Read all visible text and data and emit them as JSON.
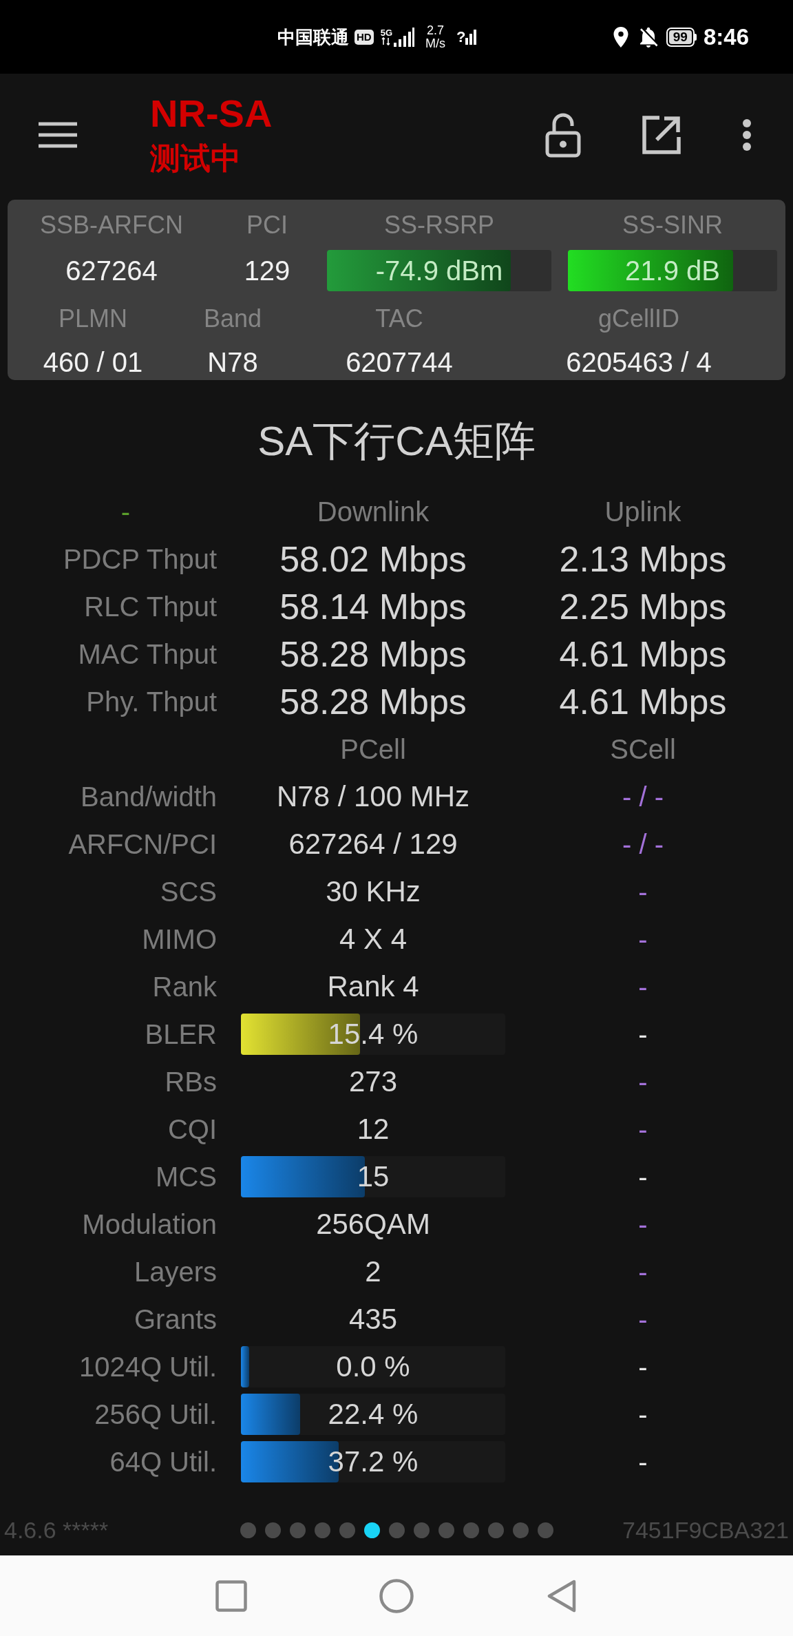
{
  "status_bar": {
    "carrier": "中国联通",
    "hd_badge": "HD",
    "network": "5G",
    "speed_value": "2.7",
    "speed_unit": "M/s",
    "sim2_mark": "?",
    "battery": "99",
    "time": "8:46"
  },
  "toolbar": {
    "title": "NR-SA",
    "subtitle": "测试中"
  },
  "cell_info": {
    "row_1": [
      {
        "kind": "text",
        "label": "SSB-ARFCN",
        "value": "627264"
      },
      {
        "kind": "text",
        "label": "PCI",
        "value": "129"
      },
      {
        "kind": "meter",
        "label": "SS-RSRP",
        "value": "-74.9 dBm",
        "level": 0.82,
        "color": "#239b3b"
      },
      {
        "kind": "meter",
        "label": "SS-SINR",
        "value": "21.9 dB",
        "level": 0.79,
        "color": "#22dd22"
      }
    ],
    "row_2": [
      {
        "label": "PLMN",
        "value": "460 / 01"
      },
      {
        "label": "Band",
        "value": "N78"
      },
      {
        "label": "TAC",
        "value": "6207744"
      },
      {
        "label": "gCellID",
        "value": "6205463 / 4"
      }
    ]
  },
  "matrix": {
    "title": "SA下行CA矩阵",
    "throughput": {
      "header": {
        "label": "-",
        "downlink": "Downlink",
        "uplink": "Uplink"
      },
      "rows": [
        {
          "label": "PDCP Thput",
          "downlink": "58.02 Mbps",
          "uplink": "2.13 Mbps"
        },
        {
          "label": "RLC Thput",
          "downlink": "58.14 Mbps",
          "uplink": "2.25 Mbps"
        },
        {
          "label": "MAC Thput",
          "downlink": "58.28 Mbps",
          "uplink": "4.61 Mbps"
        },
        {
          "label": "Phy. Thput",
          "downlink": "58.28 Mbps",
          "uplink": "4.61 Mbps"
        }
      ]
    },
    "cells": {
      "header": {
        "pcell": "PCell",
        "scell": "SCell"
      },
      "rows": [
        {
          "kind": "text",
          "label": "Band/width",
          "pcell": "N78 / 100 MHz",
          "scell": "- / -"
        },
        {
          "kind": "text",
          "label": "ARFCN/PCI",
          "pcell": "627264 / 129",
          "scell": "- / -"
        },
        {
          "kind": "text",
          "label": "SCS",
          "pcell": "30 KHz",
          "scell": "-"
        },
        {
          "kind": "text",
          "label": "MIMO",
          "pcell": "4 X 4",
          "scell": "-"
        },
        {
          "kind": "text",
          "label": "Rank",
          "pcell": "Rank 4",
          "scell": "-"
        },
        {
          "kind": "bar",
          "label": "BLER",
          "pcell": "15.4 %",
          "scell": "-",
          "level": 0.45,
          "color": "#e2e232"
        },
        {
          "kind": "text",
          "label": "RBs",
          "pcell": "273",
          "scell": "-"
        },
        {
          "kind": "text",
          "label": "CQI",
          "pcell": "12",
          "scell": "-"
        },
        {
          "kind": "bar",
          "label": "MCS",
          "pcell": "15",
          "scell": "-",
          "level": 0.47,
          "color": "#1a86e8"
        },
        {
          "kind": "text",
          "label": "Modulation",
          "pcell": "256QAM",
          "scell": "-"
        },
        {
          "kind": "text",
          "label": "Layers",
          "pcell": "2",
          "scell": "-"
        },
        {
          "kind": "text",
          "label": "Grants",
          "pcell": "435",
          "scell": "-"
        },
        {
          "kind": "bar",
          "label": "1024Q Util.",
          "pcell": "0.0 %",
          "scell": "-",
          "level": 0.03,
          "color": "#1a86e8"
        },
        {
          "kind": "bar",
          "label": "256Q Util.",
          "pcell": "22.4 %",
          "scell": "-",
          "level": 0.225,
          "color": "#1a86e8"
        },
        {
          "kind": "bar",
          "label": "64Q Util.",
          "pcell": "37.2 %",
          "scell": "-",
          "level": 0.37,
          "color": "#1a86e8"
        }
      ]
    }
  },
  "footer": {
    "version": "4.6.6 *****",
    "pages": [
      {
        "selected": false
      },
      {
        "selected": false
      },
      {
        "selected": false
      },
      {
        "selected": false
      },
      {
        "selected": false
      },
      {
        "selected": true
      },
      {
        "selected": false
      },
      {
        "selected": false
      },
      {
        "selected": false
      },
      {
        "selected": false
      },
      {
        "selected": false
      },
      {
        "selected": false
      },
      {
        "selected": false
      }
    ],
    "device_id": "7451F9CBA321"
  }
}
